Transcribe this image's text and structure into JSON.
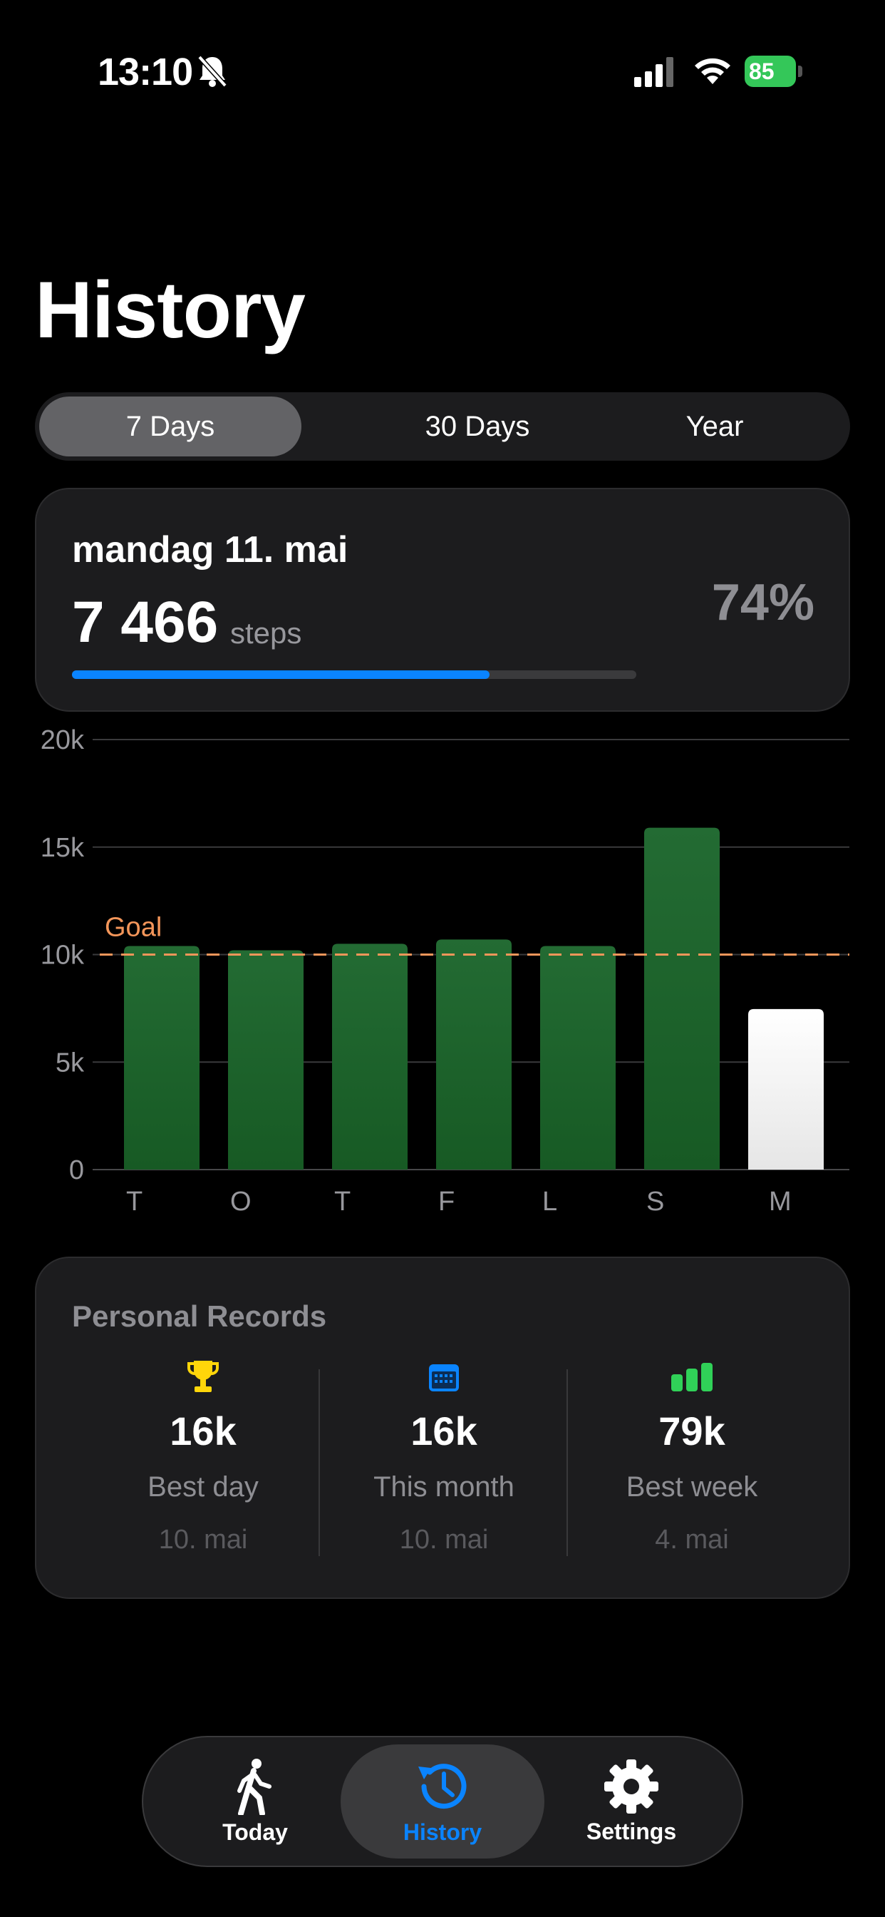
{
  "status_bar": {
    "time": "13:10",
    "battery": "85"
  },
  "page": {
    "title": "History"
  },
  "range_tabs": [
    {
      "label": "7 Days",
      "selected": true
    },
    {
      "label": "30 Days",
      "selected": false
    },
    {
      "label": "Year",
      "selected": false
    }
  ],
  "summary": {
    "date": "mandag 11. mai",
    "steps": "7 466",
    "unit": "steps",
    "percent": "74%",
    "progress": 0.74
  },
  "chart_data": {
    "type": "bar",
    "categories": [
      "T",
      "O",
      "T",
      "F",
      "L",
      "S",
      "M"
    ],
    "values": [
      10400,
      10200,
      10500,
      10700,
      10400,
      15900,
      7466
    ],
    "yticks": [
      "0",
      "5k",
      "10k",
      "15k",
      "20k"
    ],
    "ylim": [
      0,
      20000
    ],
    "goal": 10000,
    "goal_label": "Goal",
    "highlight_index": 6,
    "colors": {
      "bar": "#1c6b2f",
      "highlight": "#ffffff",
      "goal": "#f4965a",
      "grid": "#3a3a3c"
    }
  },
  "records": {
    "title": "Personal Records",
    "items": [
      {
        "icon": "trophy-icon",
        "value": "16k",
        "label": "Best day",
        "date": "10. mai"
      },
      {
        "icon": "calendar-icon",
        "value": "16k",
        "label": "This month",
        "date": "10. mai"
      },
      {
        "icon": "bar-chart-icon",
        "value": "79k",
        "label": "Best week",
        "date": "4. mai"
      }
    ]
  },
  "tabbar": [
    {
      "label": "Today",
      "icon": "walking-icon",
      "selected": false
    },
    {
      "label": "History",
      "icon": "history-clock-icon",
      "selected": true
    },
    {
      "label": "Settings",
      "icon": "gear-icon",
      "selected": false
    }
  ],
  "colors": {
    "accent": "#0a84ff",
    "bar_green": "#1c6b2f",
    "goal_orange": "#f4965a",
    "trophy": "#ffd60a",
    "week_green": "#30d158"
  }
}
